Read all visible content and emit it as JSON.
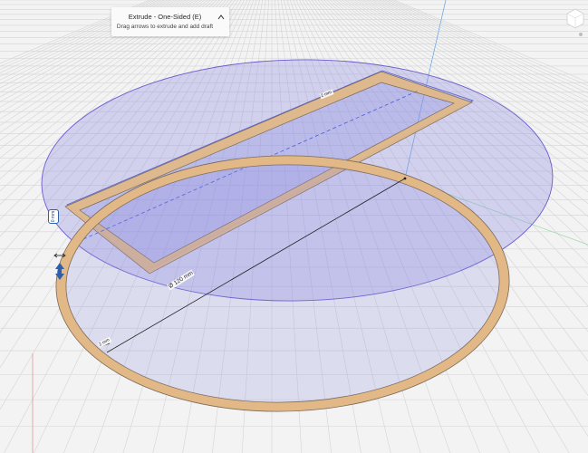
{
  "tooltip": {
    "title": "Extrude - One-Sided (E)",
    "subtitle": "Drag arrows to extrude and add draft",
    "collapse_icon": "chevron-up-icon"
  },
  "viewcube_icon": "view-cube-icon",
  "depth_input": {
    "value": "0 mm"
  },
  "extrude_handle_icon": "up-down-arrow-icon",
  "dimensions": {
    "diameter": "Ø 120 mm",
    "width_top": "2 mm",
    "width_bottom": "2 mm"
  },
  "colors": {
    "canvas": "#f3f3f3",
    "grid_line": "#d4d4d4",
    "profile_fill": "#e2b886",
    "profile_stroke": "#7a6a5a",
    "plane_fill": "#8c8ce4",
    "plane_stroke": "#6a5acd",
    "axis_green": "#9adba0",
    "axis_blue": "#5fa3e6",
    "axis_red": "#e07a7a",
    "handle_blue": "#2f5fa8"
  }
}
